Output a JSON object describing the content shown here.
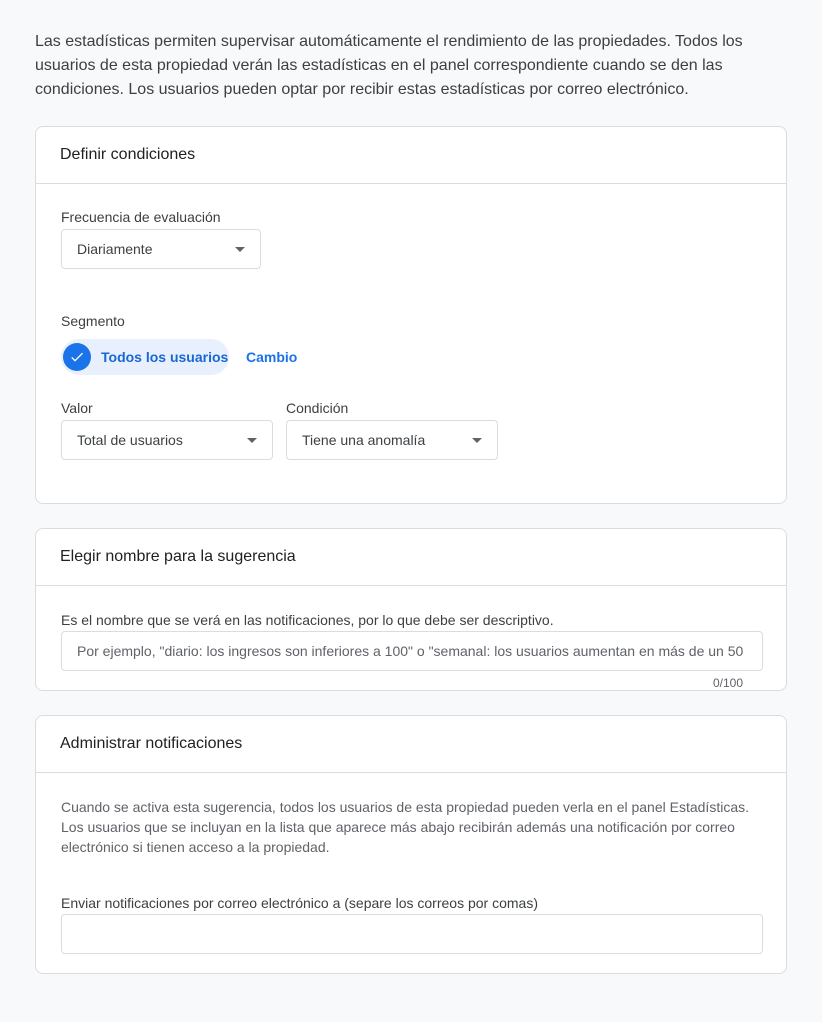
{
  "intro_text": "Las estadísticas permiten supervisar automáticamente el rendimiento de las propiedades. Todos los usuarios de esta propiedad verán las estadísticas en el panel correspondiente cuando se den las condiciones. Los usuarios pueden optar por recibir estas estadísticas por correo electrónico.",
  "conditions": {
    "title": "Definir condiciones",
    "frequency_label": "Frecuencia de evaluación",
    "frequency_value": "Diariamente",
    "segment_label": "Segmento",
    "segment_chip": "Todos los usuarios",
    "change_link": "Cambio",
    "value_label": "Valor",
    "value_selected": "Total de usuarios",
    "condition_label": "Condición",
    "condition_selected": "Tiene una anomalía"
  },
  "name": {
    "title": "Elegir nombre para la sugerencia",
    "description": "Es el nombre que se verá en las notificaciones, por lo que debe ser descriptivo.",
    "placeholder": "Por ejemplo, \"diario: los ingresos son inferiores a 100\" o \"semanal: los usuarios aumentan en más de un 50",
    "value": "",
    "counter": "0/100"
  },
  "notifications": {
    "title": "Administrar notificaciones",
    "description": "Cuando se activa esta sugerencia, todos los usuarios de esta propiedad pueden verla en el panel Estadísticas. Los usuarios que se incluyan en la lista que aparece más abajo recibirán además una notificación por correo electrónico si tienen acceso a la propiedad.",
    "email_label": "Enviar notificaciones por correo electrónico a (separe los correos por comas)",
    "email_value": ""
  },
  "colors": {
    "accent": "#1a73e8",
    "chip_bg": "#e8f0fe",
    "border": "#dadce0"
  }
}
